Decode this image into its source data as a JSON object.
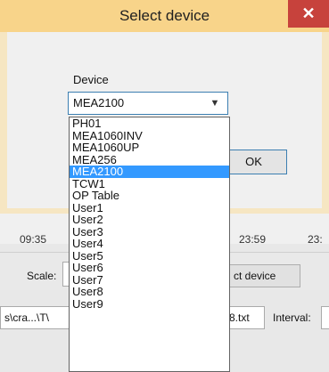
{
  "dialog": {
    "title": "Select device",
    "close_icon": "close-icon",
    "device_label": "Device",
    "selected_value": "MEA2100",
    "chevron_icon": "chevron-down-icon",
    "ok_label": "OK",
    "accent_color": "#3399ff",
    "close_color": "#c7423c"
  },
  "dropdown": {
    "selected": "MEA2100",
    "options": [
      "PH01",
      "MEA1060INV",
      "MEA1060UP",
      "MEA256",
      "MEA2100",
      "TCW1",
      "OP Table",
      "User1",
      "User2",
      "User3",
      "User4",
      "User5",
      "User6",
      "User7",
      "User8",
      "User9"
    ]
  },
  "background": {
    "ticks": [
      "09:35",
      "23:59",
      "23:"
    ],
    "scale_label": "Scale:",
    "select_device_button": "ct device",
    "path_value": "s\\cra...\\T\\",
    "file_value": "8.txt",
    "interval_label": "Interval:"
  }
}
